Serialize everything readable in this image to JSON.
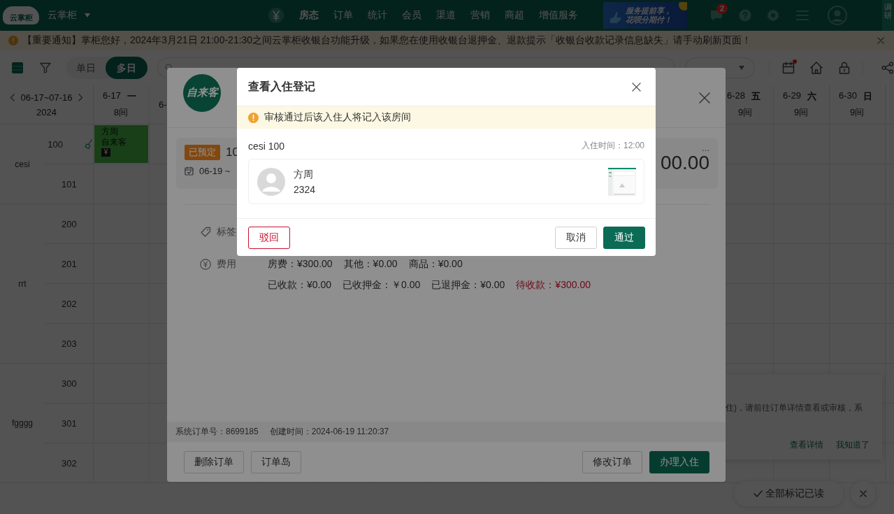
{
  "top_bar": {
    "logo_text": "云掌柜",
    "store_name": "云掌柜",
    "nav": [
      {
        "label": "房态",
        "selected": true
      },
      {
        "label": "订单",
        "selected": false
      },
      {
        "label": "统计",
        "selected": false
      },
      {
        "label": "会员",
        "selected": false
      },
      {
        "label": "渠道",
        "selected": false
      },
      {
        "label": "营销",
        "selected": false
      },
      {
        "label": "商超",
        "selected": false
      },
      {
        "label": "增值服务",
        "selected": false
      }
    ],
    "banner": [
      "服务提前享，",
      "花呗分期付！"
    ],
    "message_badge": "2",
    "survey_tab": "调研"
  },
  "notice": {
    "text": "【重要通知】掌柜您好，2024年3月21日 21:00-21:30之间云掌柜收银台功能升级，如果您在使用收银台退押金、退款提示「收银台收款记录信息缺失」请手动刷新页面！"
  },
  "toolbar": {
    "view_modes": [
      {
        "label": "单日",
        "selected": false
      },
      {
        "label": "多日",
        "selected": true
      }
    ],
    "calendar_alert": true
  },
  "board": {
    "range": "06-17~07-16",
    "year": "2024",
    "days_left": [
      {
        "date": "6-17",
        "weekday": "一",
        "rooms": "8间"
      },
      {
        "date": "6-"
      }
    ],
    "days_right": [
      {
        "date": "6-28",
        "weekday": "五",
        "rooms": "9间"
      },
      {
        "date": "6-29",
        "weekday": "六",
        "rooms": "9间"
      },
      {
        "date": "6-30",
        "weekday": "日",
        "rooms": "9间"
      }
    ],
    "room_types": [
      {
        "name": "cesi",
        "rooms": [
          {
            "number": "100",
            "needs_cleaning": true
          },
          {
            "number": "101",
            "needs_cleaning": false
          }
        ]
      },
      {
        "name": "rrt",
        "rooms": [
          {
            "number": "200",
            "needs_cleaning": false
          },
          {
            "number": "201",
            "needs_cleaning": false
          },
          {
            "number": "202",
            "needs_cleaning": false
          },
          {
            "number": "203",
            "needs_cleaning": false
          }
        ]
      },
      {
        "name": "fgggg",
        "rooms": [
          {
            "number": "300",
            "needs_cleaning": false
          },
          {
            "number": "301",
            "needs_cleaning": false
          },
          {
            "number": "302",
            "needs_cleaning": false
          }
        ]
      }
    ],
    "booking": {
      "guest": "方周",
      "source": "自来客",
      "payment_mark": "¥"
    }
  },
  "toast": {
    "text": "住)，请前往订单详情查看或审核，系",
    "actions": [
      "查看详情",
      "我知道了"
    ]
  },
  "mark_all": {
    "label": "全部标记已读"
  },
  "order_modal": {
    "source_logo": "自来客",
    "status": "已预定",
    "room": "10",
    "dates": "06-19 ~",
    "amount": "00.00",
    "more": "...",
    "tag_label": "标签",
    "fee_label": "费用",
    "fee_rows": [
      [
        {
          "text": "房费：¥300.00",
          "kind": "normal"
        },
        {
          "text": "其他：¥0.00",
          "kind": "normal"
        },
        {
          "text": "商品：¥0.00",
          "kind": "normal"
        }
      ],
      [
        {
          "text": "已收款：¥0.00",
          "kind": "normal"
        },
        {
          "text": "已收押金：￥0.00",
          "kind": "normal"
        },
        {
          "text": "已退押金：¥0.00",
          "kind": "normal"
        },
        {
          "text": "待收款：¥300.00",
          "kind": "due"
        }
      ]
    ],
    "order_no": "系统订单号：8699185",
    "created": "创建时间：2024-06-19 11:20:37",
    "left_buttons": [
      "删除订单",
      "订单岛"
    ],
    "right_buttons": [
      {
        "label": "修改订单",
        "kind": "default"
      },
      {
        "label": "办理入住",
        "kind": "primary"
      }
    ]
  },
  "checkin_dialog": {
    "title": "查看入住登记",
    "warning": "审核通过后该入住人将记入该房间",
    "room": "cesi 100",
    "checkin_time": "入住时间：12:00",
    "guests": [
      {
        "name": "方周",
        "id": "2324",
        "has_photo": true
      }
    ],
    "reject": "驳回",
    "cancel": "取消",
    "approve": "通过"
  }
}
